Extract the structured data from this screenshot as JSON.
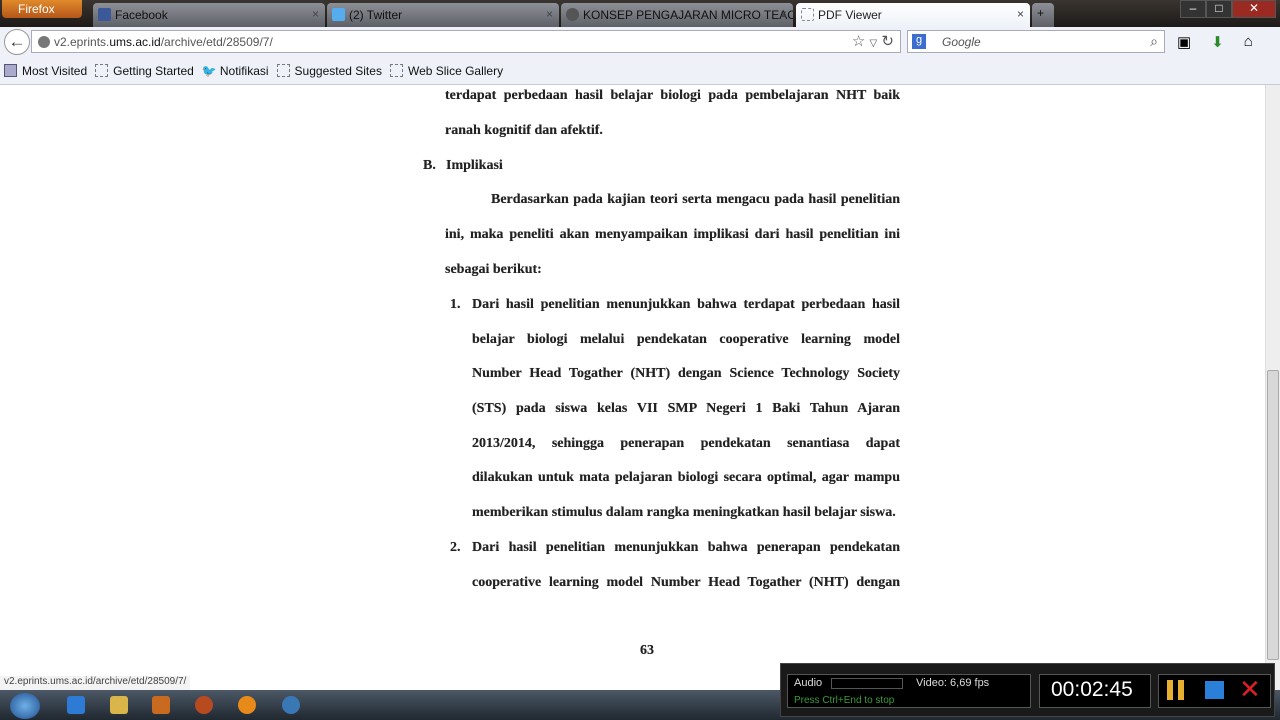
{
  "browser": {
    "menu_button": "Firefox",
    "tabs": [
      {
        "label": "Facebook"
      },
      {
        "label": "(2) Twitter"
      },
      {
        "label": "KONSEP PENGAJARAN MICRO TEAC..."
      },
      {
        "label": "PDF Viewer",
        "active": true
      }
    ],
    "url_host_prefix": "v2.eprints.",
    "url_host": "ums.ac.id",
    "url_path": "/archive/etd/28509/7/",
    "search_placeholder": "Google",
    "bookmarks": [
      "Most Visited",
      "Getting Started",
      "Notifikasi",
      "Suggested Sites",
      "Web Slice Gallery"
    ],
    "status_url": "v2.eprints.ums.ac.id/archive/etd/28509/7/"
  },
  "document": {
    "lines": [
      {
        "text": "terdapat perbedaan hasil belajar biologi pada pembelajaran NHT baik",
        "justify": true
      },
      {
        "text": "ranah kognitif dan afektif."
      },
      {
        "text": "B."
      },
      {
        "text": "Implikasi"
      },
      {
        "text": "Berdasarkan pada kajian teori serta mengacu pada hasil penelitian",
        "justify": true
      },
      {
        "text": "ini, maka peneliti akan menyampaikan implikasi dari hasil penelitian ini",
        "justify": true
      },
      {
        "text": "sebagai berikut:"
      },
      {
        "text": "1."
      },
      {
        "text": "Dari hasil penelitian menunjukkan bahwa terdapat perbedaan hasil",
        "justify": true
      },
      {
        "text": "belajar biologi melalui pendekatan cooperative learning model",
        "justify": true
      },
      {
        "text": "Number Head Togather (NHT) dengan Science Technology Society",
        "justify": true
      },
      {
        "text": "(STS) pada siswa kelas VII SMP Negeri 1 Baki Tahun Ajaran",
        "justify": true
      },
      {
        "text": "2013/2014, sehingga penerapan pendekatan senantiasa dapat",
        "justify": true
      },
      {
        "text": "dilakukan untuk mata pelajaran biologi secara optimal, agar mampu",
        "justify": true
      },
      {
        "text": "memberikan stimulus dalam rangka meningkatkan hasil belajar siswa."
      },
      {
        "text": "2."
      },
      {
        "text": "Dari hasil penelitian menunjukkan bahwa penerapan pendekatan",
        "justify": true
      },
      {
        "text": "cooperative learning model Number Head Togather (NHT) dengan",
        "justify": true
      }
    ],
    "page_number": "63"
  },
  "recorder": {
    "audio_label": "Audio",
    "video_label": "Video: 6,69 fps",
    "hint": "Press Ctrl+End to stop",
    "timer": "00:02:45"
  }
}
